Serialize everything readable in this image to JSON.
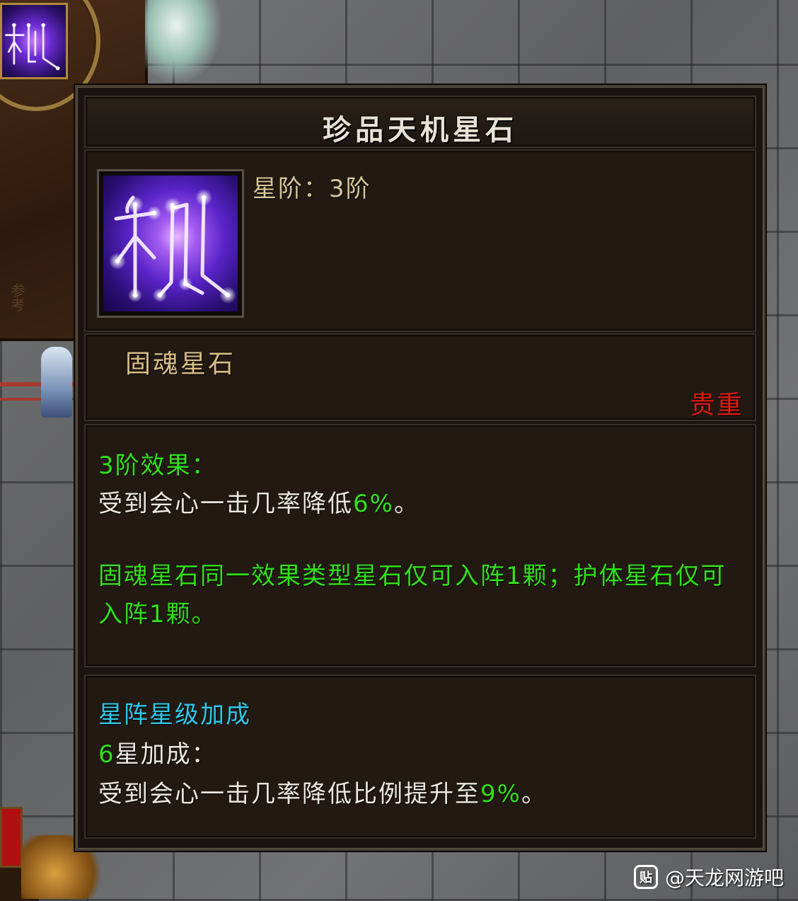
{
  "tooltip": {
    "title": "珍品天机星石",
    "star_rank": "星阶：3阶",
    "stone_name": "固魂星石",
    "rarity": "贵重",
    "effect": {
      "header": "3阶效果：",
      "desc_prefix": "受到会心一击几率降低",
      "desc_value": "6%",
      "desc_suffix": "。",
      "rule": "固魂星石同一效果类型星石仅可入阵1颗；护体星石仅可入阵1颗。"
    },
    "bonus": {
      "header": "星阵星级加成",
      "level_num": "6",
      "level_label": "星加成：",
      "desc_prefix": "受到会心一击几率降低比例提升至",
      "desc_value": "9%",
      "desc_suffix": "。"
    },
    "icon": "star-constellation-icon"
  },
  "watermark": {
    "icon_text": "贴",
    "text": "@天龙网游吧"
  },
  "colors": {
    "title": "#e8e2d6",
    "star_rank": "#d6c69a",
    "stone_name": "#d8bd86",
    "rarity": "#e01b12",
    "green": "#32e01a",
    "cyan": "#2ec8e8",
    "white": "#ece8e0"
  }
}
